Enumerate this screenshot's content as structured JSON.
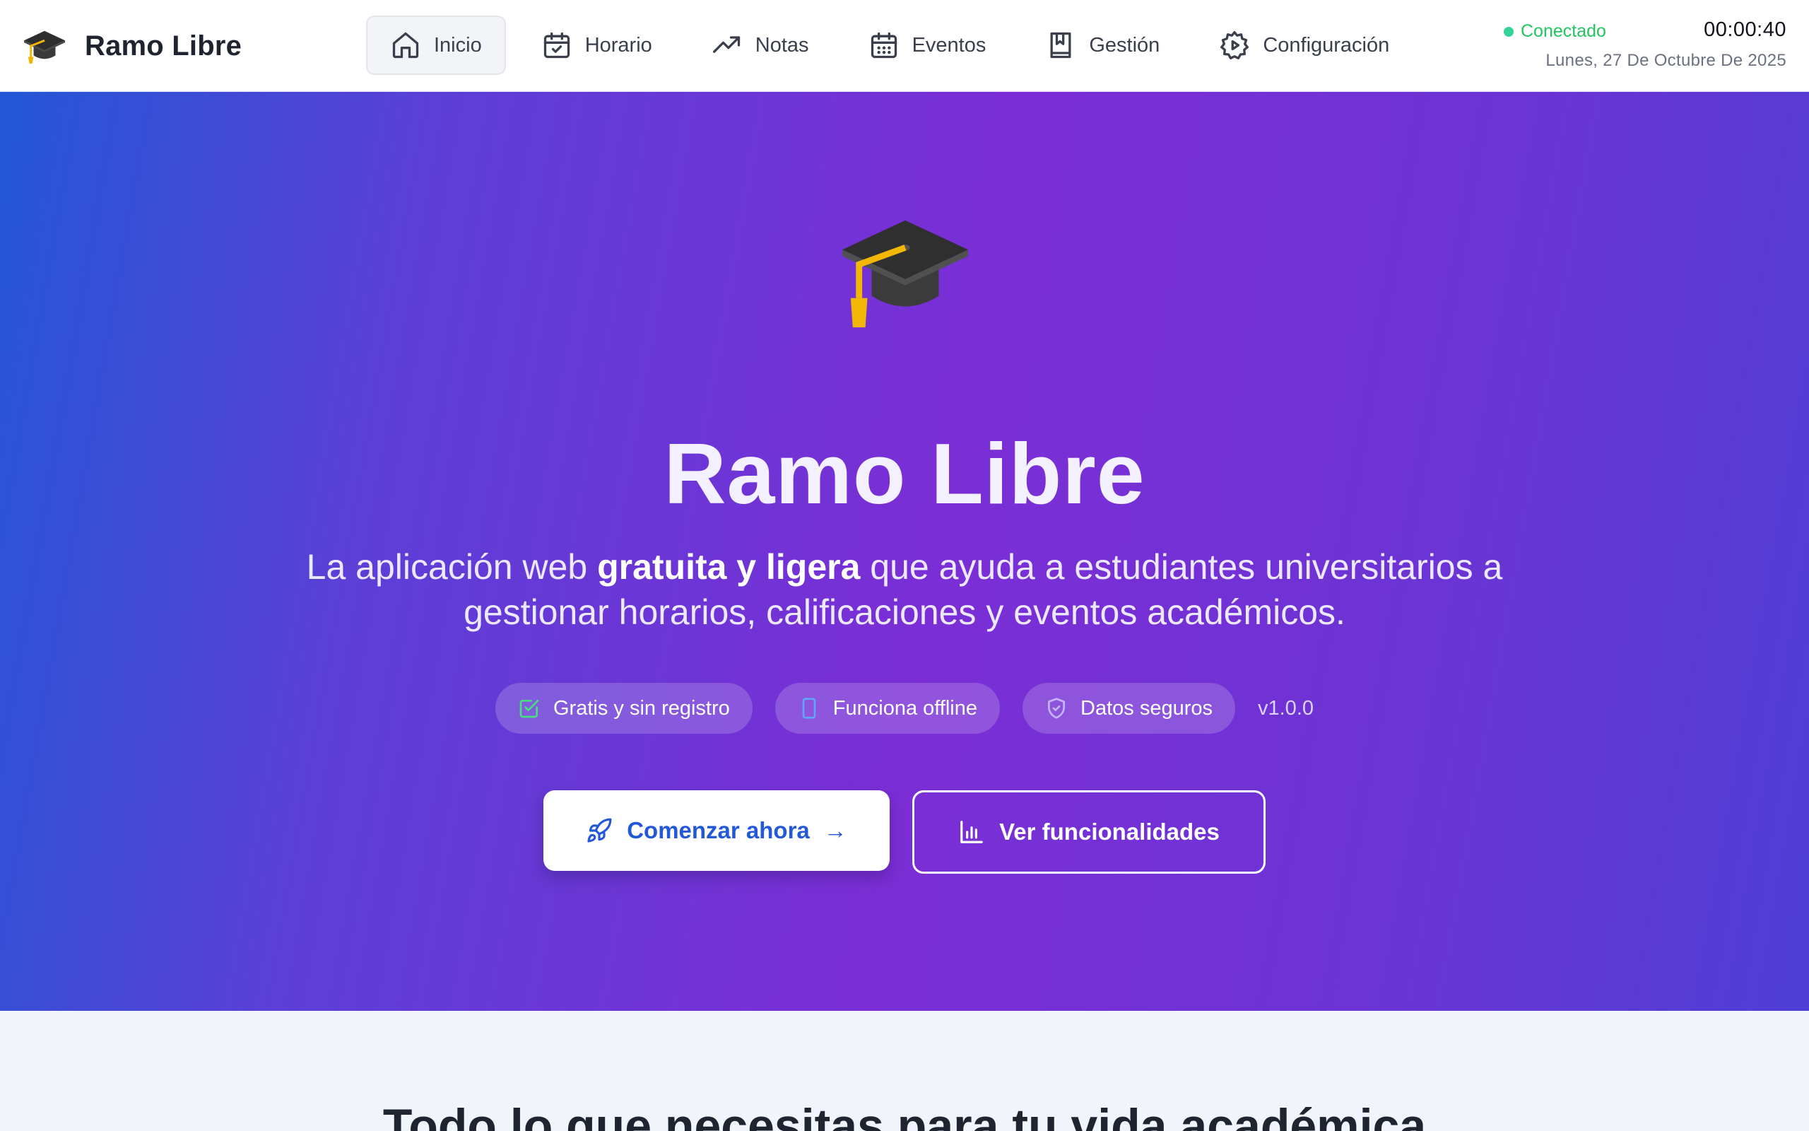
{
  "brand": {
    "name": "Ramo Libre"
  },
  "nav": {
    "items": [
      {
        "label": "Inicio",
        "icon": "home-icon"
      },
      {
        "label": "Horario",
        "icon": "calendar-check-icon"
      },
      {
        "label": "Notas",
        "icon": "trending-up-icon"
      },
      {
        "label": "Eventos",
        "icon": "calendar-grid-icon"
      },
      {
        "label": "Gestión",
        "icon": "bookmark-book-icon"
      },
      {
        "label": "Configuración",
        "icon": "gear-icon"
      }
    ],
    "active": "Inicio"
  },
  "status": {
    "label": "Conectado",
    "time": "00:00:40",
    "date": "Lunes, 27 De Octubre De 2025"
  },
  "hero": {
    "title": "Ramo Libre",
    "subtitle_before": "La aplicación web ",
    "subtitle_strong": "gratuita y ligera",
    "subtitle_after": " que ayuda a estudiantes universitarios a gestionar horarios, calificaciones y eventos académicos.",
    "badges": [
      {
        "label": "Gratis y sin registro",
        "icon": "check-square-icon"
      },
      {
        "label": "Funciona offline",
        "icon": "phone-icon"
      },
      {
        "label": "Datos seguros",
        "icon": "shield-icon"
      }
    ],
    "version": "v1.0.0",
    "primary_cta": "Comenzar ahora",
    "primary_arrow": "→",
    "secondary_cta": "Ver funcionalidades"
  },
  "features": {
    "title": "Todo lo que necesitas para tu vida académica"
  },
  "colors": {
    "accent": "#2359d8",
    "status": "#22c55e",
    "hero_start": "#2357d8",
    "hero_mid": "#7b2ed6",
    "hero_end": "#4f3fd6"
  }
}
